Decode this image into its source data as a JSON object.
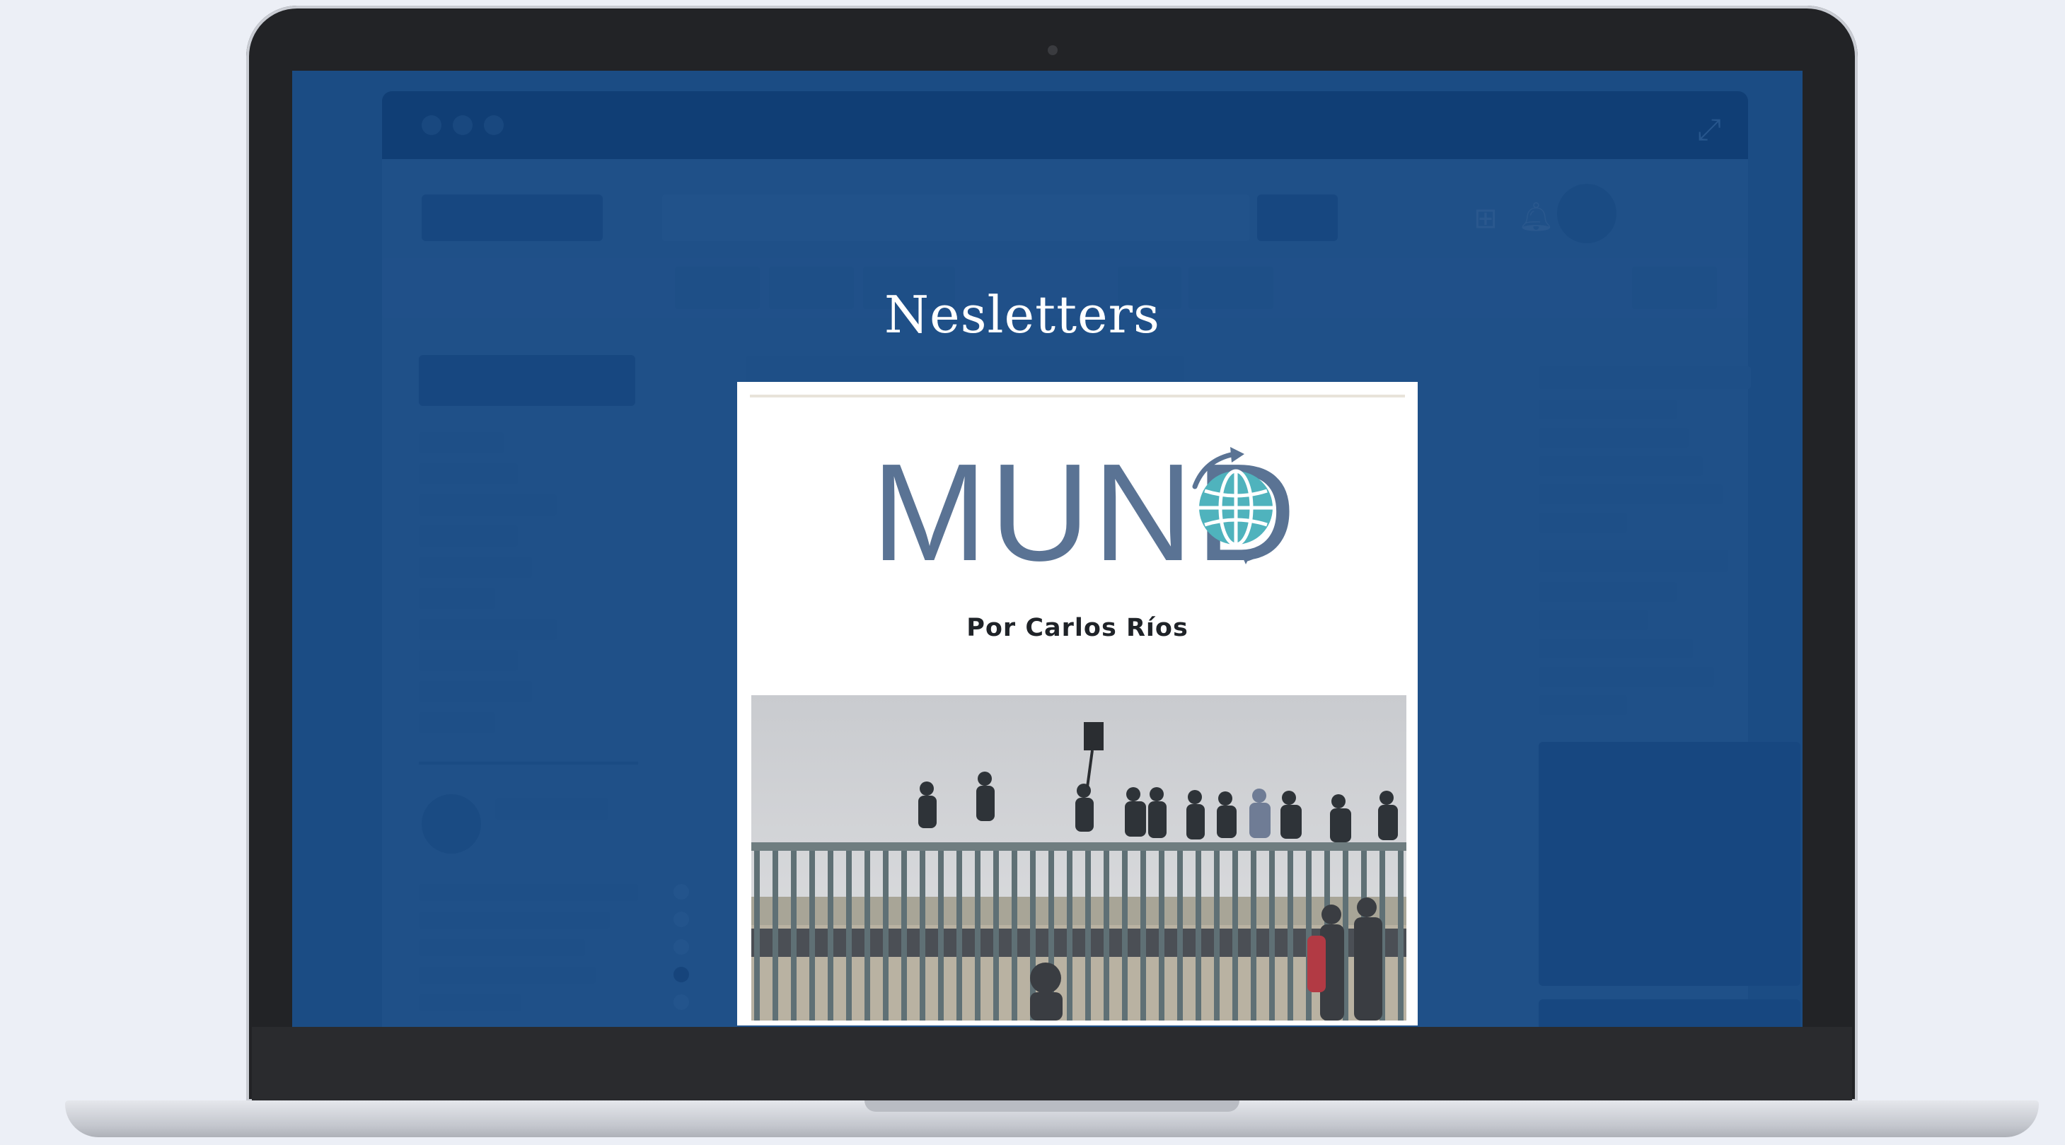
{
  "colors": {
    "screen_overlay": "#1b4a82",
    "heading_text": "#ffffff",
    "logo_text": "#5a7394",
    "globe_teal": "#4fb3bd",
    "byline_text": "#1f2328"
  },
  "window": {
    "controls": [
      "close-dot",
      "minimize-dot",
      "maximize-dot"
    ],
    "expand_icon": "expand-arrows-icon"
  },
  "header": {
    "icons": [
      "apps-grid-icon",
      "bell-icon",
      "user-avatar"
    ]
  },
  "section_heading": "Nesletters",
  "newsletter": {
    "logo_text": "MUND",
    "logo_icon": "globe-arrows-icon",
    "byline": "Por Carlos Ríos",
    "photo": "people-on-border-fence-photo"
  }
}
